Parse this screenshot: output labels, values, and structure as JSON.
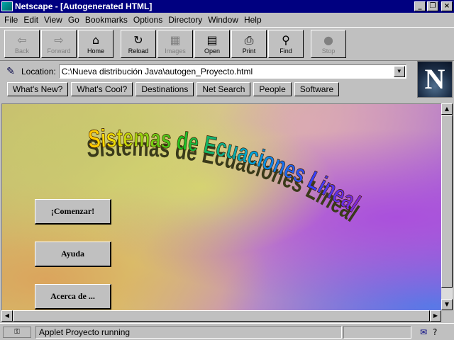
{
  "window": {
    "title": "Netscape - [Autogenerated HTML]",
    "minimize": "_",
    "restore": "❐",
    "close": "×"
  },
  "menu": [
    "File",
    "Edit",
    "View",
    "Go",
    "Bookmarks",
    "Options",
    "Directory",
    "Window",
    "Help"
  ],
  "toolbar": [
    {
      "label": "Back",
      "icon": "back-arrow-icon",
      "glyph": "⇦",
      "enabled": false
    },
    {
      "label": "Forward",
      "icon": "forward-arrow-icon",
      "glyph": "⇨",
      "enabled": false
    },
    {
      "label": "Home",
      "icon": "home-icon",
      "glyph": "⌂",
      "enabled": true
    },
    {
      "label": "Reload",
      "icon": "reload-icon",
      "glyph": "↻",
      "enabled": true
    },
    {
      "label": "Images",
      "icon": "images-icon",
      "glyph": "▦",
      "enabled": false
    },
    {
      "label": "Open",
      "icon": "open-icon",
      "glyph": "▤",
      "enabled": true
    },
    {
      "label": "Print",
      "icon": "print-icon",
      "glyph": "⎙",
      "enabled": true
    },
    {
      "label": "Find",
      "icon": "find-icon",
      "glyph": "⚲",
      "enabled": true
    },
    {
      "label": "Stop",
      "icon": "stop-icon",
      "glyph": "●",
      "enabled": false
    }
  ],
  "location": {
    "label": "Location:",
    "url": "C:\\Nueva distribución Java\\autogen_Proyecto.html",
    "icon": "bookmark-quicklink-icon"
  },
  "directory_buttons": [
    "What's New?",
    "What's Cool?",
    "Destinations",
    "Net Search",
    "People",
    "Software"
  ],
  "logo": {
    "letter": "N",
    "icon": "netscape-logo-icon"
  },
  "page": {
    "wordart_title": "Sistemas de Ecuaciones Lineales",
    "buttons": [
      "¡Comenzar!",
      "Ayuda",
      "Acerca de ..."
    ]
  },
  "status": {
    "text": "Applet Proyecto running",
    "security_icon": "security-key-icon",
    "mail_icon": "mail-icon"
  },
  "colors": {
    "titlebar": "#000080",
    "chrome": "#c0c0c0"
  }
}
